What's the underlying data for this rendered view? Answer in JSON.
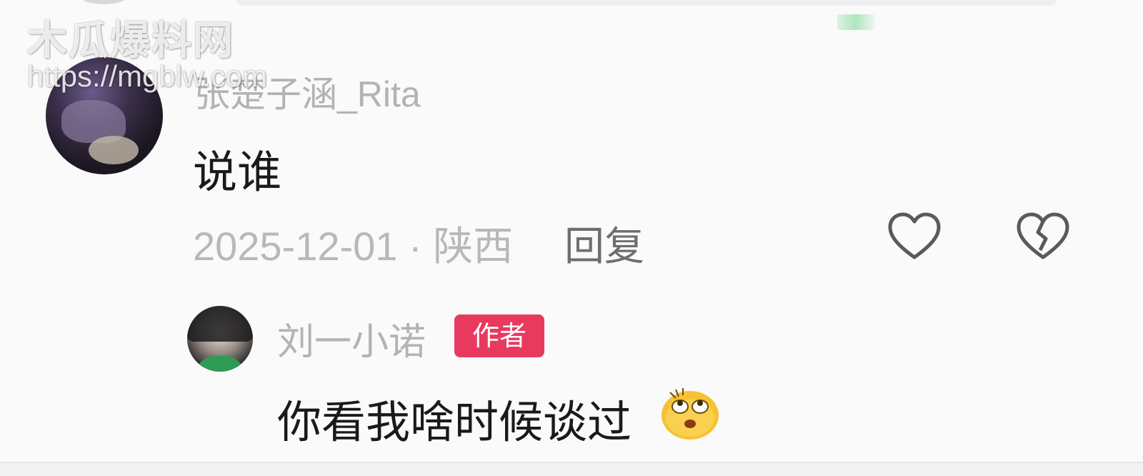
{
  "watermark": {
    "title": "木瓜爆料网",
    "url": "https://mgblw.com"
  },
  "comment": {
    "username": "张楚子涵_Rita",
    "text": "说谁",
    "date_location": "2025-12-01 · 陕西",
    "reply_label": "回复",
    "like_icon": "heart-outline-icon",
    "dislike_icon": "broken-heart-icon"
  },
  "reply": {
    "username": "刘一小诺",
    "badge": "作者",
    "text": "你看我啥时候谈过",
    "emoji_icon": "rolling-eyes-emoji-icon"
  },
  "colors": {
    "badge_bg": "#e83a5e",
    "muted_text": "#b3b3b3",
    "body_text": "#1a1a1a"
  }
}
